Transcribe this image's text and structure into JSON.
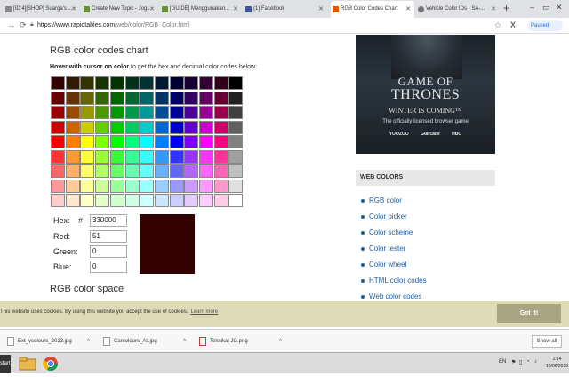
{
  "browser": {
    "tabs": [
      {
        "label": "[ID:4][SHOP] Suarga's ...",
        "favicon_color": "#888888"
      },
      {
        "label": "Create New Topic - Jog...",
        "favicon_color": "#6a8f3a"
      },
      {
        "label": "[GUIDE] Menggunakan...",
        "favicon_color": "#6a8f3a"
      },
      {
        "label": "(1) Facebook",
        "favicon_color": "#3b5998"
      },
      {
        "label": "RGB Color Codes Chart",
        "favicon_color": "#e05a00"
      },
      {
        "label": "Vehicle Color IDs - SA-...",
        "favicon_color": "#777777"
      }
    ],
    "new_tab": "+",
    "window_controls": [
      "–",
      "▭",
      "✕"
    ],
    "url_domain": "https://www.rapidtables.com",
    "url_path": "/web/color/RGB_Color.html",
    "paused_label": "Paused"
  },
  "page": {
    "chart_heading": "RGB color codes chart",
    "hover_bold": "Hover with cursor on color",
    "hover_rest": " to get the hex and decimal color codes below:",
    "hex_label": "Hex:",
    "hash": "#",
    "hex_value": "330000",
    "red_label": "Red:",
    "red_value": "51",
    "green_label": "Green:",
    "green_value": "0",
    "blue_label": "Blue:",
    "blue_value": "0",
    "selected_color": "#330000",
    "space_heading": "RGB color space"
  },
  "color_grid": [
    [
      "#330000",
      "#331900",
      "#333300",
      "#193300",
      "#003300",
      "#003319",
      "#003333",
      "#001933",
      "#000033",
      "#190033",
      "#330033",
      "#330019",
      "#000000"
    ],
    [
      "#660000",
      "#663300",
      "#666600",
      "#336600",
      "#006600",
      "#006633",
      "#006666",
      "#003366",
      "#000066",
      "#330066",
      "#660066",
      "#660033",
      "#202020"
    ],
    [
      "#990000",
      "#994c00",
      "#999900",
      "#4c9900",
      "#009900",
      "#00994c",
      "#009999",
      "#004c99",
      "#000099",
      "#4c0099",
      "#990099",
      "#99004c",
      "#404040"
    ],
    [
      "#cc0000",
      "#cc6600",
      "#cccc00",
      "#66cc00",
      "#00cc00",
      "#00cc66",
      "#00cccc",
      "#0066cc",
      "#0000cc",
      "#6600cc",
      "#cc00cc",
      "#cc0066",
      "#606060"
    ],
    [
      "#ff0000",
      "#ff8000",
      "#ffff00",
      "#80ff00",
      "#00ff00",
      "#00ff80",
      "#00ffff",
      "#0080ff",
      "#0000ff",
      "#7f00ff",
      "#ff00ff",
      "#ff007f",
      "#808080"
    ],
    [
      "#ff3333",
      "#ff9933",
      "#ffff33",
      "#99ff33",
      "#33ff33",
      "#33ff99",
      "#33ffff",
      "#3399ff",
      "#3333ff",
      "#9933ff",
      "#ff33ff",
      "#ff3399",
      "#a0a0a0"
    ],
    [
      "#ff6666",
      "#ffb266",
      "#ffff66",
      "#b2ff66",
      "#66ff66",
      "#66ffb2",
      "#66ffff",
      "#66b2ff",
      "#6666ff",
      "#b266ff",
      "#ff66ff",
      "#ff66b2",
      "#c0c0c0"
    ],
    [
      "#ff9999",
      "#ffcc99",
      "#ffff99",
      "#ccff99",
      "#99ff99",
      "#99ffcc",
      "#99ffff",
      "#99ccff",
      "#9999ff",
      "#cc99ff",
      "#ff99ff",
      "#ff99cc",
      "#e0e0e0"
    ],
    [
      "#ffcccc",
      "#ffe5cc",
      "#ffffcc",
      "#e5ffcc",
      "#ccffcc",
      "#ccffe5",
      "#ccffff",
      "#cce5ff",
      "#ccccff",
      "#e5ccff",
      "#ffccff",
      "#ffcce5",
      "#ffffff"
    ]
  ],
  "ad": {
    "title_line1": "GAME OF",
    "title_line2": "THRONES",
    "tagline": "WINTER IS COMING™",
    "subline": "The officially licensed browser game",
    "logos": [
      "YOOZOO",
      "Gtarcade",
      "HBO"
    ]
  },
  "sidebar": {
    "heading": "WEB COLORS",
    "links": [
      "RGB color",
      "Color picker",
      "Color scheme",
      "Color tester",
      "Color wheel",
      "HTML color codes",
      "Web color codes"
    ]
  },
  "cookie": {
    "message": "This website uses cookies. By using this website you accept the use of cookies.",
    "learn_more": "Learn more",
    "button": "Got it!"
  },
  "downloads": {
    "items": [
      "Ext_vcolours_2013.jpg",
      "Carcolours_All.jpg",
      "Teknikal JG.png"
    ],
    "show_all": "Show all"
  },
  "taskbar": {
    "start": "start",
    "lang": "EN",
    "time": "2:14",
    "date": "16/06/2018"
  }
}
